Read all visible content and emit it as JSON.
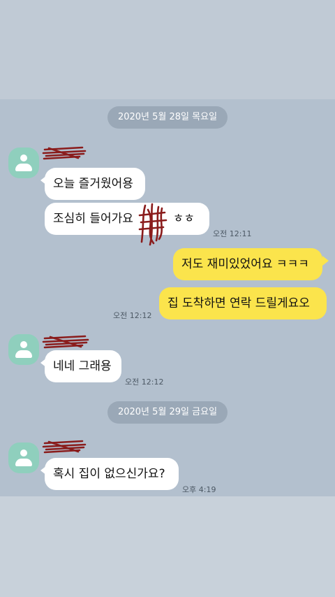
{
  "dates": [
    {
      "label": "2020년 5월 28일 목요일"
    },
    {
      "label": "2020년 5월 29일 금요일"
    }
  ],
  "messages": [
    {
      "sender": "other",
      "text": "오늘 즐거웠어용"
    },
    {
      "sender": "other",
      "text": "조심히 들어가요",
      "suffix": "ㅎㅎ",
      "time": "오전 12:11"
    },
    {
      "sender": "me",
      "text": "저도 재미있었어요 ㅋㅋㅋ"
    },
    {
      "sender": "me",
      "text": "집 도착하면 연락 드릴게요오",
      "time": "오전 12:12"
    },
    {
      "sender": "other",
      "text": "네네 그래용",
      "time": "오전 12:12"
    },
    {
      "sender": "other",
      "text": "혹시 집이 없으신가요?",
      "time": "오후 4:19"
    }
  ],
  "colors": {
    "chat_background": "#b3c0ce",
    "incoming_bubble": "#ffffff",
    "outgoing_bubble": "#fbe44c",
    "avatar": "#8fcfbd",
    "redaction_scribble": "#8a1c1c"
  },
  "icons": {
    "avatar": "default-profile-icon"
  }
}
